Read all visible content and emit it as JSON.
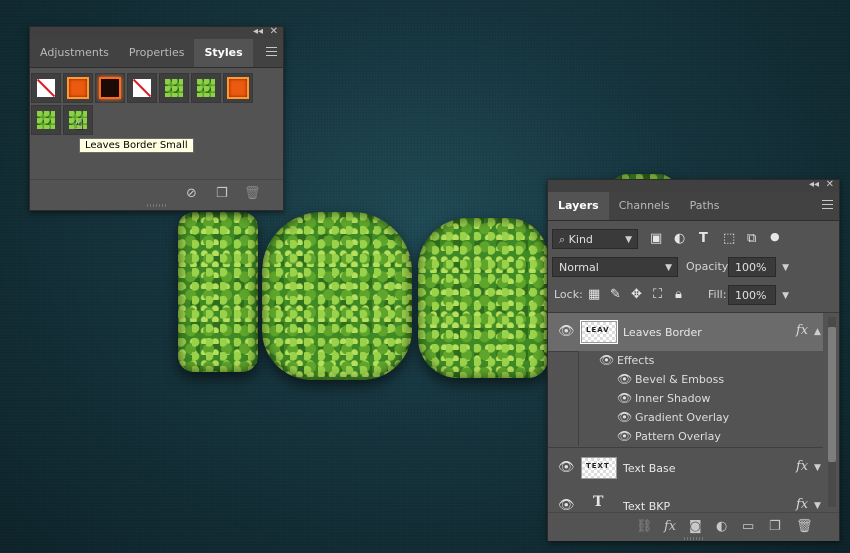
{
  "styles_panel": {
    "tabs": [
      {
        "label": "Adjustments",
        "active": false
      },
      {
        "label": "Properties",
        "active": false
      },
      {
        "label": "Styles",
        "active": true
      }
    ],
    "swatches": [
      "none",
      "orange",
      "dark-fire",
      "none",
      "leaves",
      "leaves",
      "orange",
      "leaves",
      "leaves"
    ],
    "tooltip": "Leaves Border Small",
    "footer_icons": [
      "clear-style-icon",
      "new-style-icon",
      "delete-style-icon"
    ]
  },
  "layers_panel": {
    "tabs": [
      {
        "label": "Layers",
        "active": true
      },
      {
        "label": "Channels",
        "active": false
      },
      {
        "label": "Paths",
        "active": false
      }
    ],
    "filter": {
      "kind_label": "Kind"
    },
    "blend_mode": "Normal",
    "opacity_label": "Opacity:",
    "opacity_value": "100%",
    "lock_label": "Lock:",
    "fill_label": "Fill:",
    "fill_value": "100%",
    "layers": [
      {
        "name": "Leaves Border",
        "fx": "fx",
        "selected": true
      },
      {
        "name": "Text Base",
        "fx": "fx",
        "selected": false
      },
      {
        "name": "Text BKP",
        "fx": "fx",
        "selected": false
      }
    ],
    "effects_label": "Effects",
    "effects": [
      "Bevel & Emboss",
      "Inner Shadow",
      "Gradient Overlay",
      "Pattern Overlay"
    ]
  },
  "colors": {
    "panel_bg": "#535353",
    "tab_bar": "#424242",
    "selected_row": "#6b6b6b",
    "canvas": "#15333c",
    "leaf_green": "#3f8a25"
  }
}
